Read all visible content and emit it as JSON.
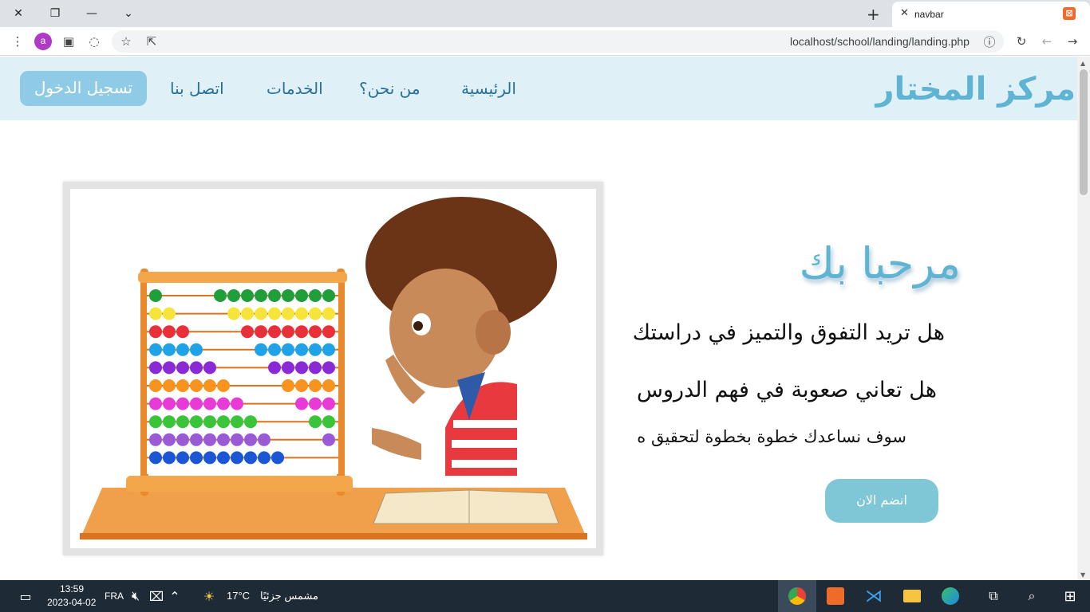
{
  "browser": {
    "tab_title": "navbar",
    "url": "localhost/school/landing/landing.php",
    "profile_initial": "a"
  },
  "navbar": {
    "brand": "مركز المختار",
    "links": [
      "الرئيسية",
      "من نحن؟",
      "الخدمات",
      "اتصل بنا"
    ],
    "login_label": "تسجيل الدخول"
  },
  "hero": {
    "welcome": "مرحبا بك",
    "question1": "هل تريد التفوق والتميز في دراستك",
    "question2": "هل تعاني صعوبة في فهم الدروس",
    "line3": "سوف نساعدك خطوة بخطوة لتحقيق ه",
    "join_label": "انضم الان"
  },
  "taskbar": {
    "time": "13:59",
    "date": "2023-04-02",
    "lang": "FRA",
    "temperature": "17°C",
    "weather": "مشمس جزئيًا"
  },
  "colors": {
    "navbar_bg": "#dff0f7",
    "brand": "#5fb3d3",
    "nav_link": "#2a6f97",
    "login_bg": "#8fcbe6",
    "join_bg": "#7fc6d6",
    "taskbar_bg": "#1e2a36"
  }
}
